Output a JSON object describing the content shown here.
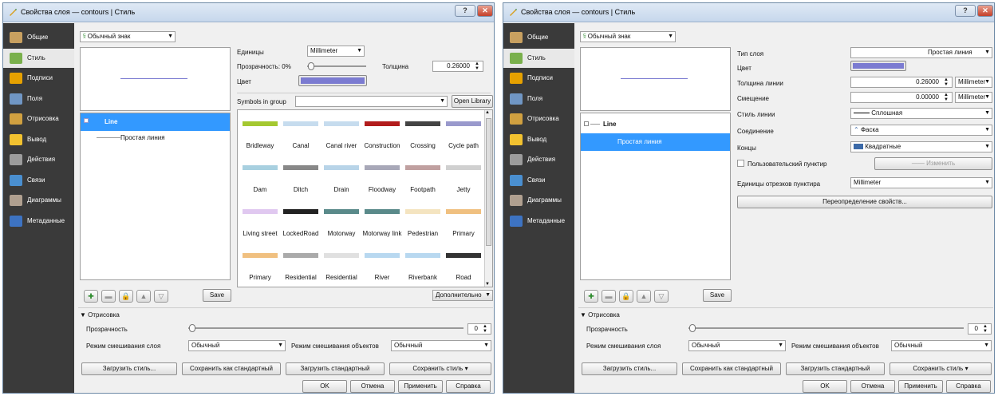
{
  "left": {
    "title": "Свойства слоя — contours | Стиль",
    "sidebar": [
      {
        "label": "Общие",
        "icon": "general-icon",
        "color": "#c8a060"
      },
      {
        "label": "Стиль",
        "icon": "style-icon",
        "color": "#7ab04c"
      },
      {
        "label": "Подписи",
        "icon": "labels-icon",
        "color": "#e6a100"
      },
      {
        "label": "Поля",
        "icon": "fields-icon",
        "color": "#7096c4"
      },
      {
        "label": "Отрисовка",
        "icon": "rendering-icon",
        "color": "#d0a040"
      },
      {
        "label": "Вывод",
        "icon": "display-icon",
        "color": "#f2c230"
      },
      {
        "label": "Действия",
        "icon": "actions-icon",
        "color": "#9c9c9c"
      },
      {
        "label": "Связи",
        "icon": "joins-icon",
        "color": "#4a8fd0"
      },
      {
        "label": "Диаграммы",
        "icon": "diagrams-icon",
        "color": "#b0a090"
      },
      {
        "label": "Метаданные",
        "icon": "metadata-icon",
        "color": "#3d73c2"
      }
    ],
    "renderer": "Обычный знак",
    "units_label": "Единицы",
    "units_value": "Millimeter",
    "transparency_label": "Прозрачность: 0%",
    "width_label": "Толщина",
    "width_value": "0.26000",
    "color_label": "Цвет",
    "color_value": "#7b7bd1",
    "symbols_in_group": "Symbols in group",
    "open_library": "Open Library",
    "tree_root": "Line",
    "tree_child": "Простая линия",
    "symbols": [
      {
        "name": "Bridleway",
        "color": "#a4c830"
      },
      {
        "name": "Canal",
        "color": "#c6dcee"
      },
      {
        "name": "Canal river",
        "color": "#c6dcee"
      },
      {
        "name": "Construction",
        "color": "#b21c1c"
      },
      {
        "name": "Crossing",
        "color": "#444444"
      },
      {
        "name": "Cycle path",
        "color": "#9999cc"
      },
      {
        "name": "Dam",
        "color": "#a8d0e0"
      },
      {
        "name": "Ditch",
        "color": "#888888"
      },
      {
        "name": "Drain",
        "color": "#b8d4e8"
      },
      {
        "name": "Floodway",
        "color": "#a8a8b8"
      },
      {
        "name": "Footpath",
        "color": "#c0a0a0"
      },
      {
        "name": "Jetty",
        "color": "#d0d0d0"
      },
      {
        "name": "Living street",
        "color": "#e0c8f0"
      },
      {
        "name": "LockedRoad",
        "color": "#222222"
      },
      {
        "name": "Motorway",
        "color": "#5a8a8a"
      },
      {
        "name": "Motorway link",
        "color": "#5a8a8a"
      },
      {
        "name": "Pedestrian",
        "color": "#f4e4c0"
      },
      {
        "name": "Primary",
        "color": "#f0c080"
      },
      {
        "name": "Primary",
        "color": "#f0c080"
      },
      {
        "name": "Residential",
        "color": "#aaaaaa"
      },
      {
        "name": "Residential",
        "color": "#e0e0e0"
      },
      {
        "name": "River",
        "color": "#b8d8f0"
      },
      {
        "name": "Riverbank",
        "color": "#b8d8f0"
      },
      {
        "name": "Road",
        "color": "#333333"
      }
    ],
    "save": "Save",
    "advanced": "Дополнительно",
    "rendering_section": "Отрисовка",
    "transparency": "Прозрачность",
    "transparency_value": "0",
    "layer_blend_label": "Режим смешивания слоя",
    "layer_blend_value": "Обычный",
    "feature_blend_label": "Режим смешивания объектов",
    "feature_blend_value": "Обычный",
    "load_style": "Загрузить стиль...",
    "save_default": "Сохранить как стандартный",
    "load_default": "Загрузить стандартный",
    "save_style": "Сохранить стиль",
    "ok": "OK",
    "cancel": "Отмена",
    "apply": "Применить",
    "help": "Справка"
  },
  "right": {
    "title": "Свойства слоя — contours | Стиль",
    "renderer": "Обычный знак",
    "layer_type_label": "Тип слоя",
    "layer_type_value": "Простая линия",
    "color_label": "Цвет",
    "color_value": "#7b7bd1",
    "pen_width_label": "Толщина линии",
    "pen_width_value": "0.26000",
    "pen_width_unit": "Millimeter",
    "offset_label": "Смещение",
    "offset_value": "0.00000",
    "offset_unit": "Millimeter",
    "pen_style_label": "Стиль линии",
    "pen_style_value": "Сплошная",
    "join_label": "Соединение",
    "join_value": "Фаска",
    "cap_label": "Концы",
    "cap_value": "Квадратные",
    "custom_dash_label": "Пользовательский пунктир",
    "change_button": "Изменить",
    "dash_units_label": "Единицы отрезков пунктира",
    "dash_units_value": "Millimeter",
    "data_defined": "Переопределение свойств...",
    "tree_root": "Line",
    "tree_child": "Простая линия",
    "save": "Save",
    "rendering_section": "Отрисовка",
    "transparency": "Прозрачность",
    "transparency_value": "0",
    "layer_blend_label": "Режим смешивания слоя",
    "layer_blend_value": "Обычный",
    "feature_blend_label": "Режим смешивания объектов",
    "feature_blend_value": "Обычный",
    "load_style": "Загрузить стиль...",
    "save_default": "Сохранить как стандартный",
    "load_default": "Загрузить стандартный",
    "save_style": "Сохранить стиль",
    "ok": "OK",
    "cancel": "Отмена",
    "apply": "Применить",
    "help": "Справка"
  }
}
